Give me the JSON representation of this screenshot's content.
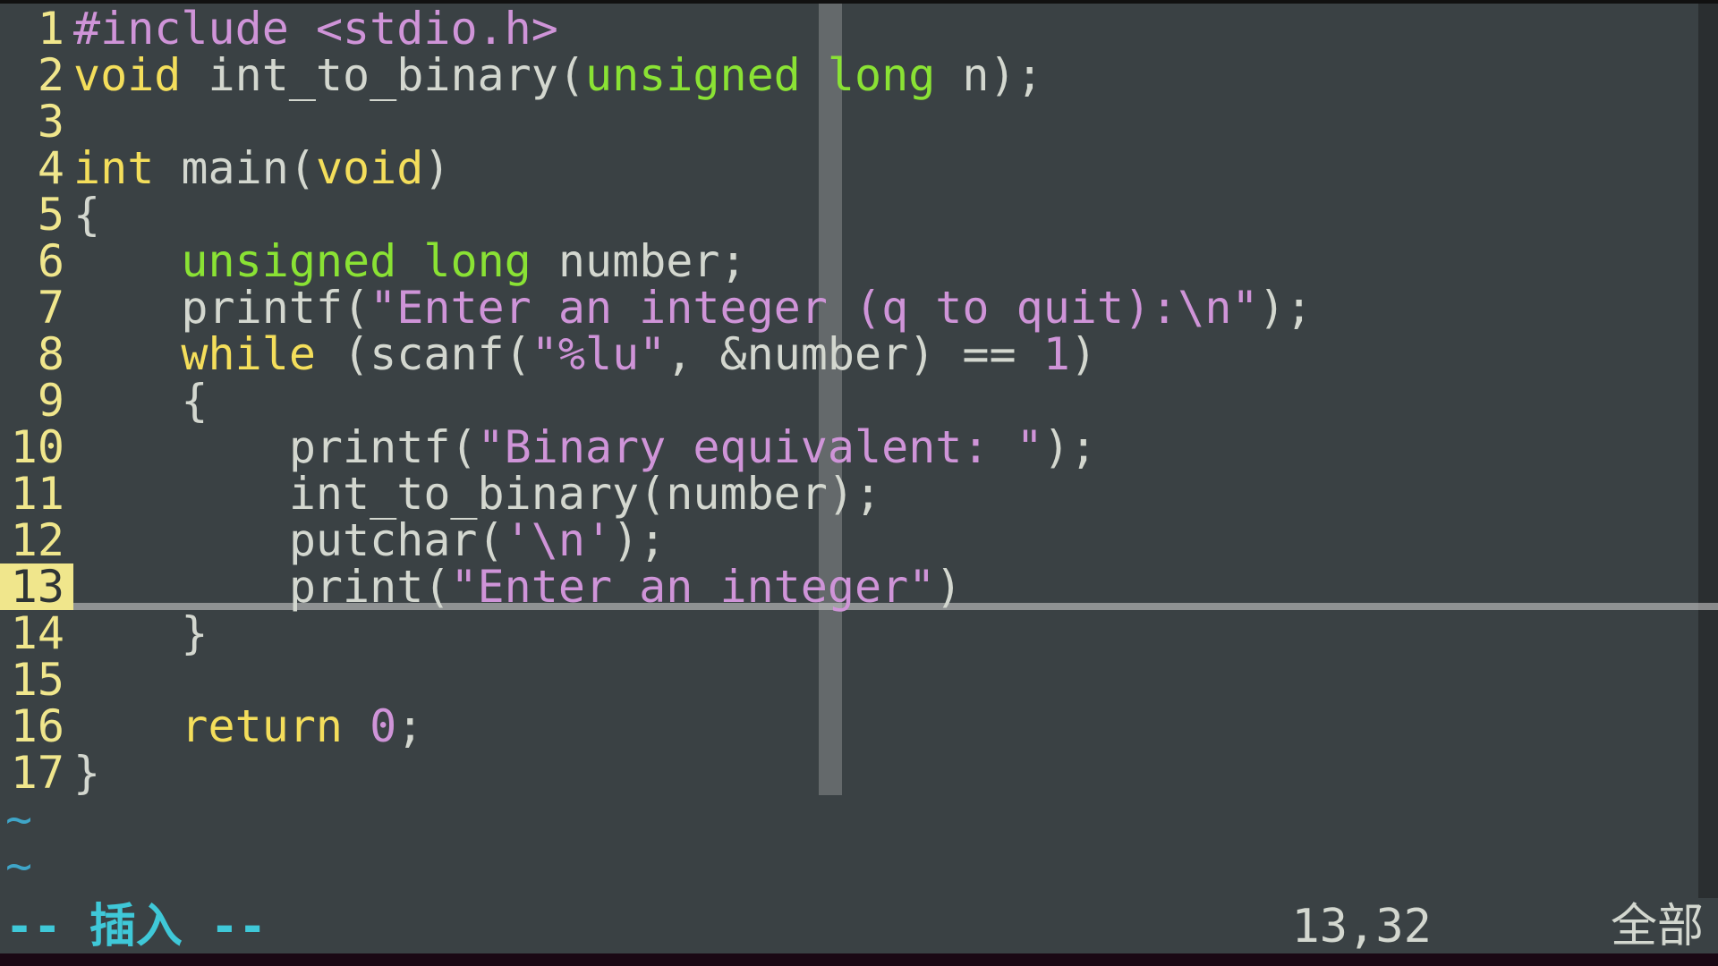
{
  "status": {
    "mode": "-- 插入 --",
    "position": "13,32",
    "percent": "全部"
  },
  "tilde": "~",
  "lines": [
    {
      "n": "1",
      "segments": [
        [
          "pp",
          "#include "
        ],
        [
          "mac",
          "<stdio.h>"
        ]
      ]
    },
    {
      "n": "2",
      "segments": [
        [
          "kw",
          "void"
        ],
        [
          "plain",
          " int_to_binary("
        ],
        [
          "type",
          "unsigned"
        ],
        [
          "plain",
          " "
        ],
        [
          "type",
          "long"
        ],
        [
          "plain",
          " n);"
        ]
      ]
    },
    {
      "n": "3",
      "segments": [
        [
          "plain",
          ""
        ]
      ]
    },
    {
      "n": "4",
      "segments": [
        [
          "kw",
          "int"
        ],
        [
          "plain",
          " main("
        ],
        [
          "kw",
          "void"
        ],
        [
          "plain",
          ")"
        ]
      ]
    },
    {
      "n": "5",
      "segments": [
        [
          "plain",
          "{"
        ]
      ]
    },
    {
      "n": "6",
      "segments": [
        [
          "plain",
          "    "
        ],
        [
          "type",
          "unsigned"
        ],
        [
          "plain",
          " "
        ],
        [
          "type",
          "long"
        ],
        [
          "plain",
          " number;"
        ]
      ]
    },
    {
      "n": "7",
      "segments": [
        [
          "plain",
          "    printf("
        ],
        [
          "str",
          "\"Enter an integer (q to quit):\\n\""
        ],
        [
          "plain",
          ");"
        ]
      ]
    },
    {
      "n": "8",
      "segments": [
        [
          "plain",
          "    "
        ],
        [
          "kw",
          "while"
        ],
        [
          "plain",
          " (scanf("
        ],
        [
          "str",
          "\"%lu\""
        ],
        [
          "plain",
          ", &number) == "
        ],
        [
          "num",
          "1"
        ],
        [
          "plain",
          ")"
        ]
      ]
    },
    {
      "n": "9",
      "segments": [
        [
          "plain",
          "    {"
        ]
      ]
    },
    {
      "n": "10",
      "segments": [
        [
          "plain",
          "        printf("
        ],
        [
          "str",
          "\"Binary equivalent: \""
        ],
        [
          "plain",
          ");"
        ]
      ]
    },
    {
      "n": "11",
      "segments": [
        [
          "plain",
          "        int_to_binary(number);"
        ]
      ]
    },
    {
      "n": "12",
      "segments": [
        [
          "plain",
          "        putchar("
        ],
        [
          "chr",
          "'\\n'"
        ],
        [
          "plain",
          ");"
        ]
      ]
    },
    {
      "n": "13",
      "segments": [
        [
          "plain",
          "        print("
        ],
        [
          "str",
          "\"Enter an integer\""
        ],
        [
          "plain",
          ")"
        ]
      ],
      "current": true
    },
    {
      "n": "14",
      "segments": [
        [
          "plain",
          "    }"
        ]
      ]
    },
    {
      "n": "15",
      "segments": [
        [
          "plain",
          ""
        ]
      ]
    },
    {
      "n": "16",
      "segments": [
        [
          "plain",
          "    "
        ],
        [
          "kw",
          "return"
        ],
        [
          "plain",
          " "
        ],
        [
          "num",
          "0"
        ],
        [
          "plain",
          ";"
        ]
      ]
    },
    {
      "n": "17",
      "segments": [
        [
          "plain",
          "}"
        ]
      ]
    }
  ],
  "tilde_rows": 2
}
